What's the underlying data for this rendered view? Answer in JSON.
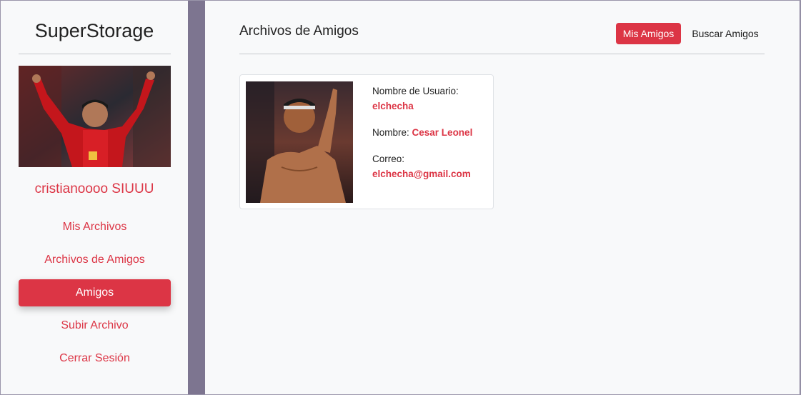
{
  "sidebar": {
    "brand": "SuperStorage",
    "username": "cristianoooo SIUUU",
    "nav": [
      {
        "label": "Mis Archivos"
      },
      {
        "label": "Archivos de Amigos"
      },
      {
        "label": "Amigos"
      },
      {
        "label": "Subir Archivo"
      },
      {
        "label": "Cerrar Sesión"
      }
    ]
  },
  "main": {
    "title": "Archivos de Amigos",
    "buttons": {
      "mis_amigos": "Mis Amigos",
      "buscar_amigos": "Buscar Amigos"
    },
    "friend": {
      "username_label": "Nombre de Usuario:",
      "username": "elchecha",
      "name_label": "Nombre:",
      "name": "Cesar Leonel",
      "email_label": "Correo:",
      "email": "elchecha@gmail.com"
    }
  },
  "colors": {
    "accent": "#dc3545",
    "panel": "#f8f9fa",
    "backdrop": "#7d7590"
  }
}
